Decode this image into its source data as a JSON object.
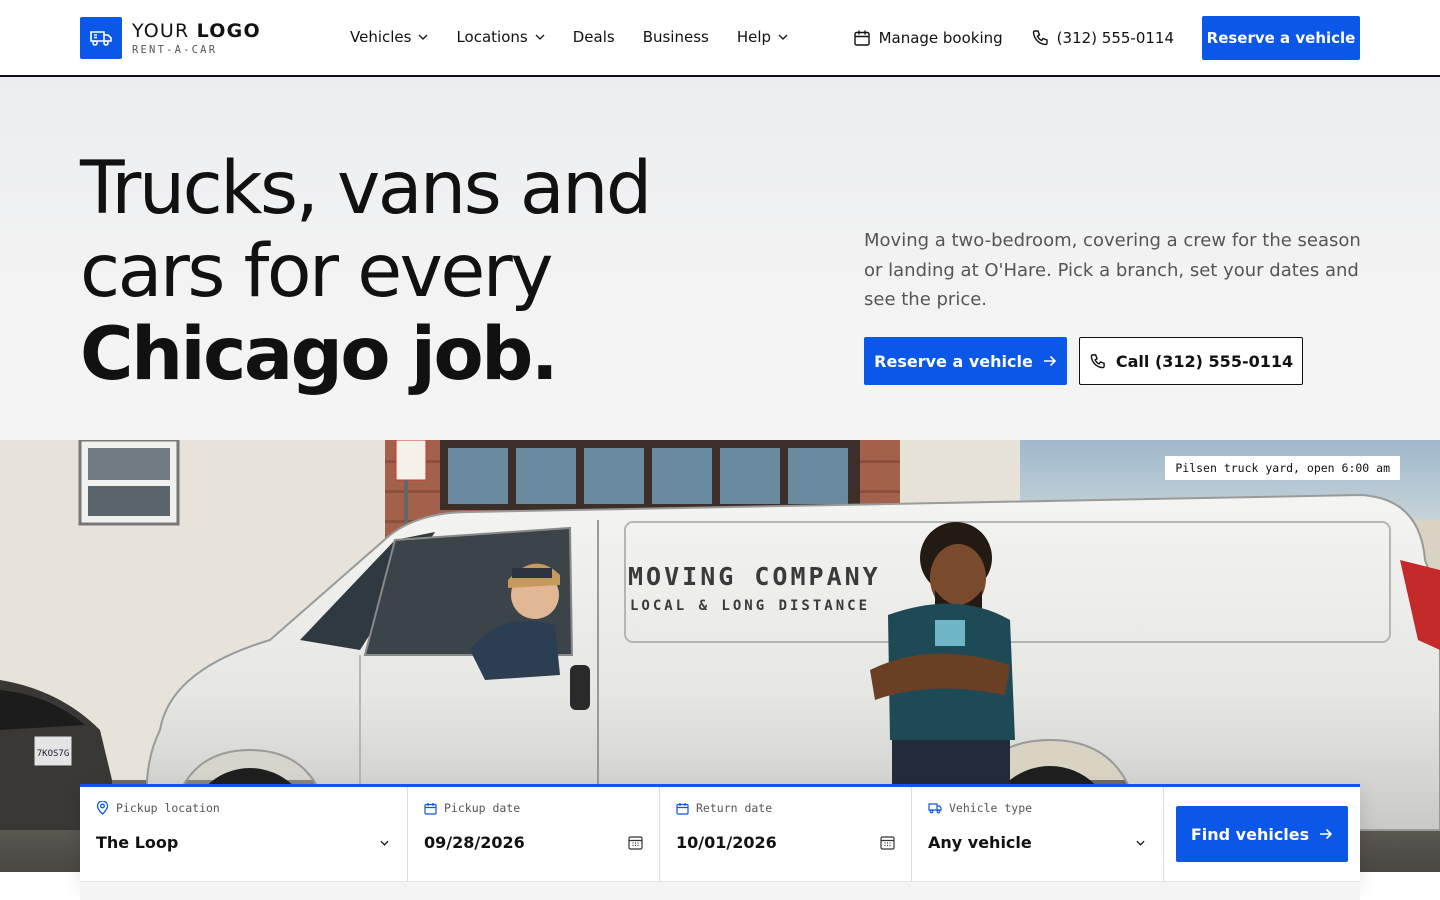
{
  "logo": {
    "title_regular": "YOUR ",
    "title_bold": "LOGO",
    "subtitle": "RENT-A-CAR",
    "icon": "van-icon"
  },
  "nav": {
    "items": [
      {
        "label": "Vehicles",
        "dropdown": true
      },
      {
        "label": "Locations",
        "dropdown": true
      },
      {
        "label": "Deals",
        "dropdown": false
      },
      {
        "label": "Business",
        "dropdown": false
      },
      {
        "label": "Help",
        "dropdown": true
      }
    ]
  },
  "header_right": {
    "manage_booking": "Manage booking",
    "phone": "(312) 555-0114",
    "reserve_label": "Reserve a vehicle"
  },
  "hero": {
    "title_line1": "Trucks, vans and",
    "title_line2": "cars for every",
    "title_line3": "Chicago job.",
    "description": "Moving a two-bedroom, covering a crew for the season or landing at O'Hare. Pick a branch, set your dates and see the price.",
    "primary_cta": "Reserve a vehicle",
    "secondary_cta": "Call (312) 555-0114"
  },
  "photo": {
    "tag": "Pilsen truck yard, open 6:00 am",
    "van_text_line1": "MOVING  COMPANY",
    "van_text_line2": "LOCAL & LONG DISTANCE",
    "plate": "7KOS7G"
  },
  "booking": {
    "pickup_location": {
      "label": "Pickup location",
      "value": "The Loop"
    },
    "pickup_date": {
      "label": "Pickup date",
      "value": "09/28/2026"
    },
    "return_date": {
      "label": "Return date",
      "value": "10/01/2026"
    },
    "vehicle_type": {
      "label": "Vehicle type",
      "value": "Any vehicle"
    },
    "find_label": "Find vehicles"
  },
  "colors": {
    "accent": "#0b57e8",
    "text": "#111111",
    "muted": "#555555",
    "hero_bg": "#f3f3f3"
  }
}
